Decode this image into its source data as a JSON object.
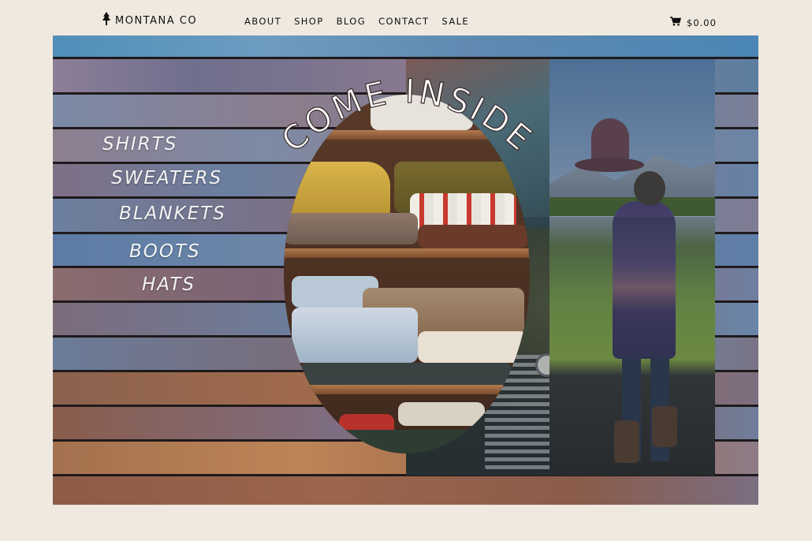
{
  "header": {
    "logo_text": "MONTANA CO",
    "logo_icon": "tree-icon",
    "nav": [
      "ABOUT",
      "SHOP",
      "BLOG",
      "CONTACT",
      "SALE"
    ],
    "cart_icon": "cart-icon",
    "cart_total": "$0.00"
  },
  "hero": {
    "heading": "COME INSIDE",
    "categories": [
      "SHIRTS",
      "SWEATERS",
      "BLANKETS",
      "BOOTS",
      "HATS"
    ]
  },
  "colors": {
    "background": "#efe9e0",
    "text": "#111111",
    "category_text": "#f4f4f4"
  }
}
